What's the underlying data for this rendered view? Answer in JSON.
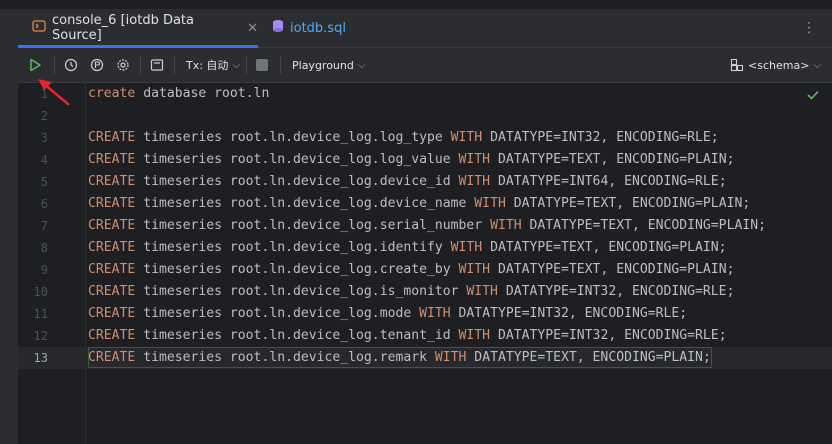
{
  "tabs": [
    {
      "label": "console_6 [iotdb Data Source]",
      "active": true,
      "icon": "console-icon"
    },
    {
      "label": "iotdb.sql",
      "active": false,
      "icon": "sql-file-icon"
    }
  ],
  "toolbar": {
    "tx_label": "Tx: 自动",
    "playground_label": "Playground",
    "schema_label": "<schema>"
  },
  "editor": {
    "current_line": 13,
    "lines": [
      {
        "n": "1",
        "parts": [
          {
            "t": "create",
            "k": true
          },
          {
            "t": " database root.ln"
          }
        ]
      },
      {
        "n": "2",
        "parts": []
      },
      {
        "n": "3",
        "parts": [
          {
            "t": "CREATE",
            "k": true
          },
          {
            "t": " timeseries root.ln.device_log.log_type "
          },
          {
            "t": "WITH",
            "k": true
          },
          {
            "t": " DATATYPE=INT32, ENCODING=RLE;"
          }
        ]
      },
      {
        "n": "4",
        "parts": [
          {
            "t": "CREATE",
            "k": true
          },
          {
            "t": " timeseries root.ln.device_log.log_value "
          },
          {
            "t": "WITH",
            "k": true
          },
          {
            "t": " DATATYPE=TEXT, ENCODING=PLAIN;"
          }
        ]
      },
      {
        "n": "5",
        "parts": [
          {
            "t": "CREATE",
            "k": true
          },
          {
            "t": " timeseries root.ln.device_log.device_id "
          },
          {
            "t": "WITH",
            "k": true
          },
          {
            "t": " DATATYPE=INT64, ENCODING=RLE;"
          }
        ]
      },
      {
        "n": "6",
        "parts": [
          {
            "t": "CREATE",
            "k": true
          },
          {
            "t": " timeseries root.ln.device_log.device_name "
          },
          {
            "t": "WITH",
            "k": true
          },
          {
            "t": " DATATYPE=TEXT, ENCODING=PLAIN;"
          }
        ]
      },
      {
        "n": "7",
        "parts": [
          {
            "t": "CREATE",
            "k": true
          },
          {
            "t": " timeseries root.ln.device_log.serial_number "
          },
          {
            "t": "WITH",
            "k": true
          },
          {
            "t": " DATATYPE=TEXT, ENCODING=PLAIN;"
          }
        ]
      },
      {
        "n": "8",
        "parts": [
          {
            "t": "CREATE",
            "k": true
          },
          {
            "t": " timeseries root.ln.device_log.identify "
          },
          {
            "t": "WITH",
            "k": true
          },
          {
            "t": " DATATYPE=TEXT, ENCODING=PLAIN;"
          }
        ]
      },
      {
        "n": "9",
        "parts": [
          {
            "t": "CREATE",
            "k": true
          },
          {
            "t": " timeseries root.ln.device_log.create_by "
          },
          {
            "t": "WITH",
            "k": true
          },
          {
            "t": " DATATYPE=TEXT, ENCODING=PLAIN;"
          }
        ]
      },
      {
        "n": "10",
        "parts": [
          {
            "t": "CREATE",
            "k": true
          },
          {
            "t": " timeseries root.ln.device_log.is_monitor "
          },
          {
            "t": "WITH",
            "k": true
          },
          {
            "t": " DATATYPE=INT32, ENCODING=RLE;"
          }
        ]
      },
      {
        "n": "11",
        "parts": [
          {
            "t": "CREATE",
            "k": true
          },
          {
            "t": " timeseries root.ln.device_log.mode "
          },
          {
            "t": "WITH",
            "k": true
          },
          {
            "t": " DATATYPE=INT32, ENCODING=RLE;"
          }
        ]
      },
      {
        "n": "12",
        "parts": [
          {
            "t": "CREATE",
            "k": true
          },
          {
            "t": " timeseries root.ln.device_log.tenant_id "
          },
          {
            "t": "WITH",
            "k": true
          },
          {
            "t": " DATATYPE=INT32, ENCODING=RLE;"
          }
        ]
      },
      {
        "n": "13",
        "parts": [
          {
            "t": "CREATE",
            "k": true
          },
          {
            "t": " timeseries root.ln.device_log.remark "
          },
          {
            "t": "WITH",
            "k": true
          },
          {
            "t": " DATATYPE=TEXT, ENCODING=PLAIN;"
          }
        ]
      }
    ]
  },
  "colors": {
    "keyword": "#cf8e6d",
    "text": "#bcbec4",
    "accent": "#3574f0",
    "run_green": "#5fb865",
    "annotation_arrow": "#e0282a"
  }
}
